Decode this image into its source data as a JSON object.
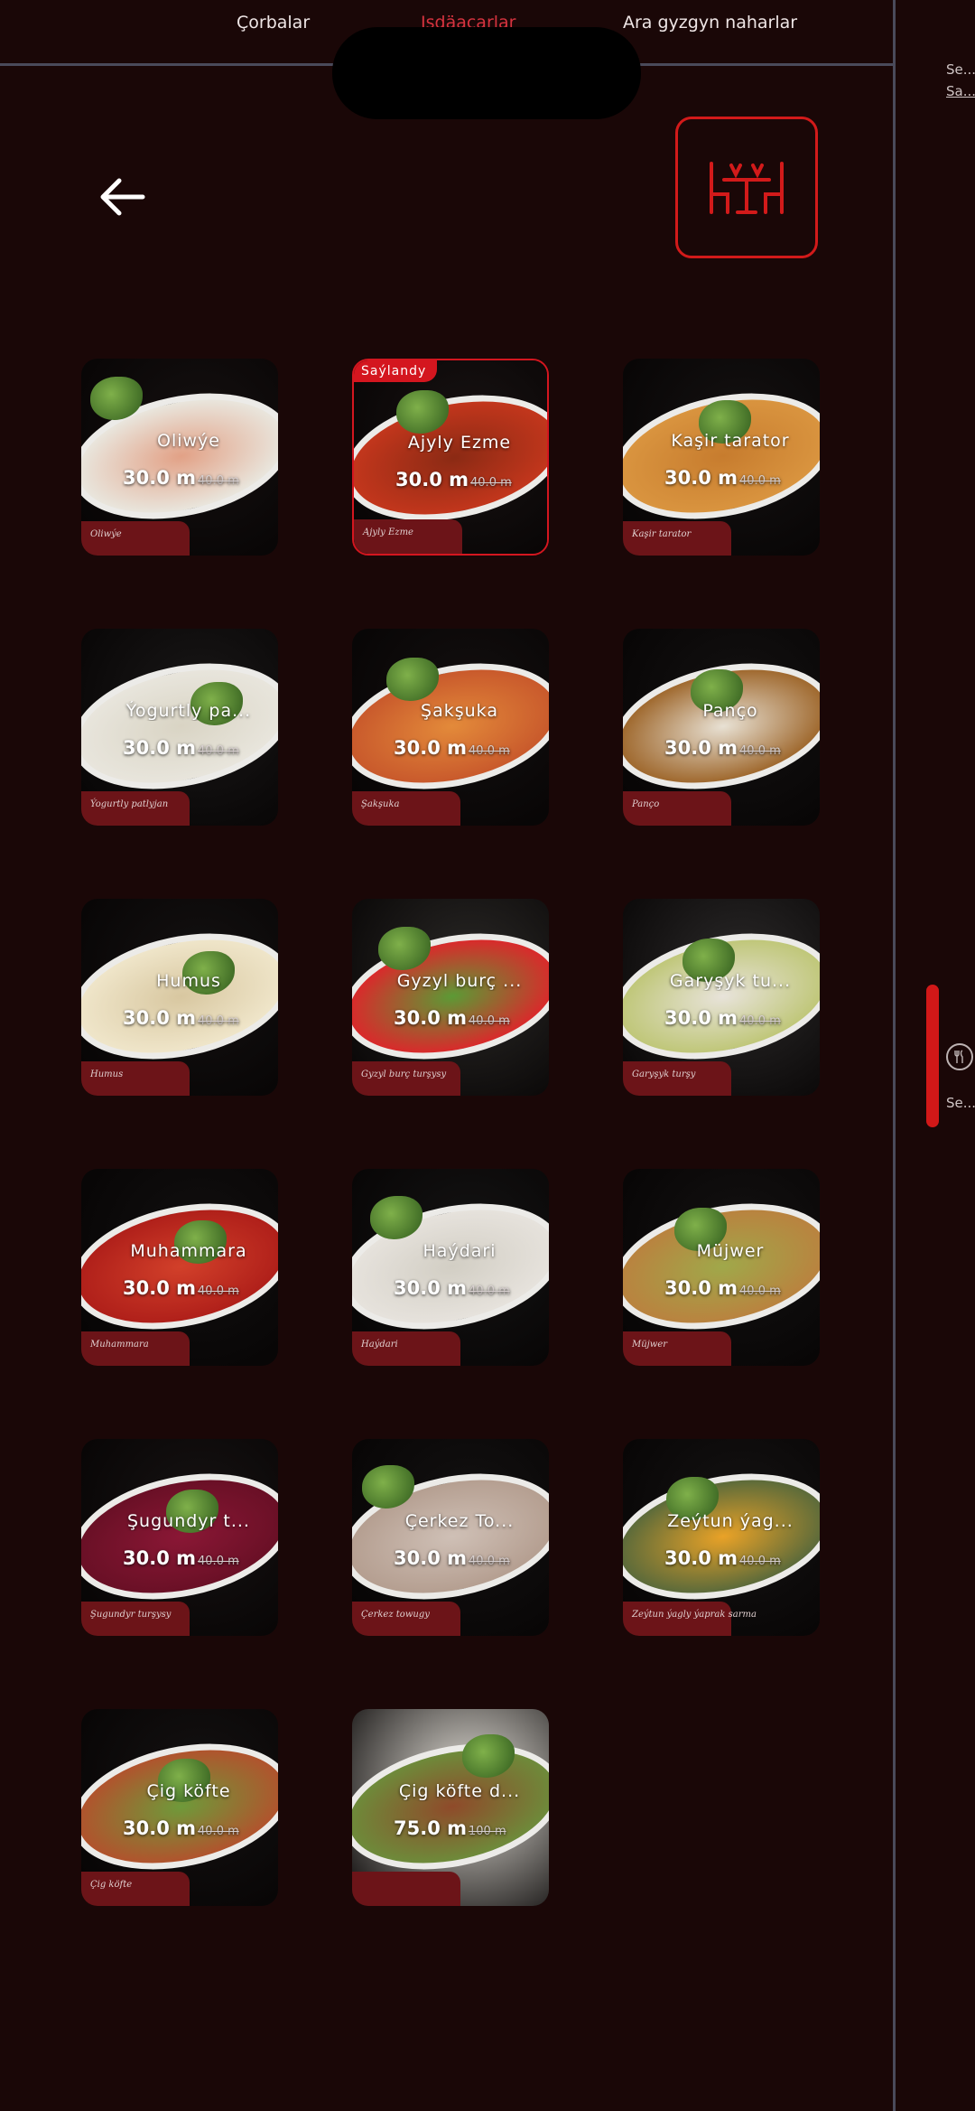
{
  "header": {
    "tabs": [
      {
        "label": "Çorbalar"
      },
      {
        "label": "Işdäaçarlar",
        "active": true
      },
      {
        "label": "Ara gyzgyn naharlar"
      }
    ]
  },
  "right_panel": {
    "items": [
      "Se...",
      "Sa...",
      "Se..."
    ]
  },
  "colors": {
    "background": "#1a0707",
    "accent": "#d4161f",
    "divider": "#4a4a5a"
  },
  "icons": {
    "back": "arrow-left-icon",
    "table": "dining-table-icon",
    "right_item": "cutlery-icon"
  },
  "currency_note": "prices shown with old price struck through",
  "badge_label": "Saýlandy",
  "items": [
    {
      "name": "Oliwýe",
      "price": "30.0 m",
      "old_price": "40.0 m",
      "caption": "Oliwýe",
      "selected": false
    },
    {
      "name": "Ajyly Ezme",
      "price": "30.0 m",
      "old_price": "40.0 m",
      "caption": "Ajyly Ezme",
      "selected": true
    },
    {
      "name": "Kaşir tarator",
      "price": "30.0 m",
      "old_price": "40.0 m",
      "caption": "Kaşir tarator",
      "selected": false
    },
    {
      "name": "Ýogurtly pa...",
      "price": "30.0 m",
      "old_price": "40.0 m",
      "caption": "Ýogurtly patlyjan",
      "selected": false
    },
    {
      "name": "Şakşuka",
      "price": "30.0 m",
      "old_price": "40.0 m",
      "caption": "Şakşuka",
      "selected": false
    },
    {
      "name": "Panço",
      "price": "30.0 m",
      "old_price": "40.0 m",
      "caption": "Panço",
      "selected": false
    },
    {
      "name": "Humus",
      "price": "30.0 m",
      "old_price": "40.0 m",
      "caption": "Humus",
      "selected": false
    },
    {
      "name": "Gyzyl burç ...",
      "price": "30.0 m",
      "old_price": "40.0 m",
      "caption": "Gyzyl burç turşysy",
      "selected": false
    },
    {
      "name": "Garyşyk tu...",
      "price": "30.0 m",
      "old_price": "40.0 m",
      "caption": "Garyşyk turşy",
      "selected": false
    },
    {
      "name": "Muhammara",
      "price": "30.0 m",
      "old_price": "40.0 m",
      "caption": "Muhammara",
      "selected": false
    },
    {
      "name": "Haýdari",
      "price": "30.0 m",
      "old_price": "40.0 m",
      "caption": "Haýdari",
      "selected": false
    },
    {
      "name": "Müjwer",
      "price": "30.0 m",
      "old_price": "40.0 m",
      "caption": "Müjwer",
      "selected": false
    },
    {
      "name": "Şugundyr t...",
      "price": "30.0 m",
      "old_price": "40.0 m",
      "caption": "Şugundyr turşysy",
      "selected": false
    },
    {
      "name": "Çerkez To...",
      "price": "30.0 m",
      "old_price": "40.0 m",
      "caption": "Çerkez towugy",
      "selected": false
    },
    {
      "name": "Zeýtun ýag...",
      "price": "30.0 m",
      "old_price": "40.0 m",
      "caption": "Zeýtun ýagly ýaprak sarma",
      "selected": false
    },
    {
      "name": "Çig köfte",
      "price": "30.0 m",
      "old_price": "40.0 m",
      "caption": "Çig köfte",
      "selected": false
    },
    {
      "name": "Çig köfte d...",
      "price": "75.0 m",
      "old_price": "100 m",
      "caption": "",
      "selected": false
    }
  ]
}
